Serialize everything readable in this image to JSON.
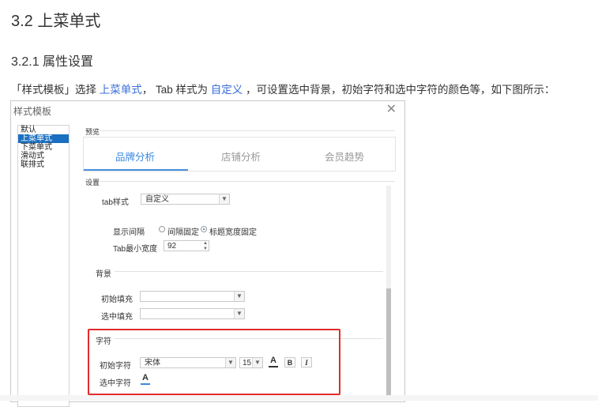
{
  "doc": {
    "heading": "3.2 上菜单式",
    "subheading": "3.2.1 属性设置",
    "para_before_1": "「样式模板」选择 ",
    "link1": "上菜单式",
    "para_mid": "， Tab 样式为 ",
    "link2": "自定义",
    "para_after": " ，可设置选中背景，初始字符和选中字符的颜色等，如下图所示："
  },
  "dialog": {
    "title": "样式模板",
    "close_glyph": "✕",
    "style_list": [
      "默认",
      "上菜单式",
      "下菜单式",
      "滑动式",
      "联排式"
    ],
    "selected_index": 1,
    "preview_label": "预览",
    "tabs": [
      "品牌分析",
      "店铺分析",
      "会员趋势"
    ],
    "active_tab": 0,
    "settings_label": "设置",
    "tab_style_label": "tab样式",
    "tab_style_value": "自定义",
    "spacing_label": "显示间隔",
    "radio_fixed_spacing": "间隔固定",
    "radio_fixed_width": "标题宽度固定",
    "radio_selected": "fixed_width",
    "min_width_label": "Tab最小宽度",
    "min_width_value": "92",
    "background_label": "背景",
    "initial_fill_label": "初始填充",
    "initial_fill_value": "",
    "selected_fill_label": "选中填充",
    "selected_fill_value": "",
    "char_label": "字符",
    "initial_char_label": "初始字符",
    "font_value": "宋体",
    "font_size_value": "15",
    "bold_label": "B",
    "italic_label": "I",
    "font_color_glyph": "A",
    "selected_char_label": "选中字符"
  },
  "colors": {
    "link": "#3a6fd8",
    "selected_item": "#1a6fc0",
    "active_tab": "#3a88e0",
    "highlight_border": "#e32b2b",
    "font_color_initial": "#333333",
    "font_color_selected": "#3a88e0"
  },
  "icons": {
    "close": "close-icon",
    "dropdown": "chevron-down-icon",
    "spinner": "spinner-arrows-icon",
    "font_color": "font-color-icon",
    "bold": "bold-icon",
    "italic": "italic-icon"
  }
}
